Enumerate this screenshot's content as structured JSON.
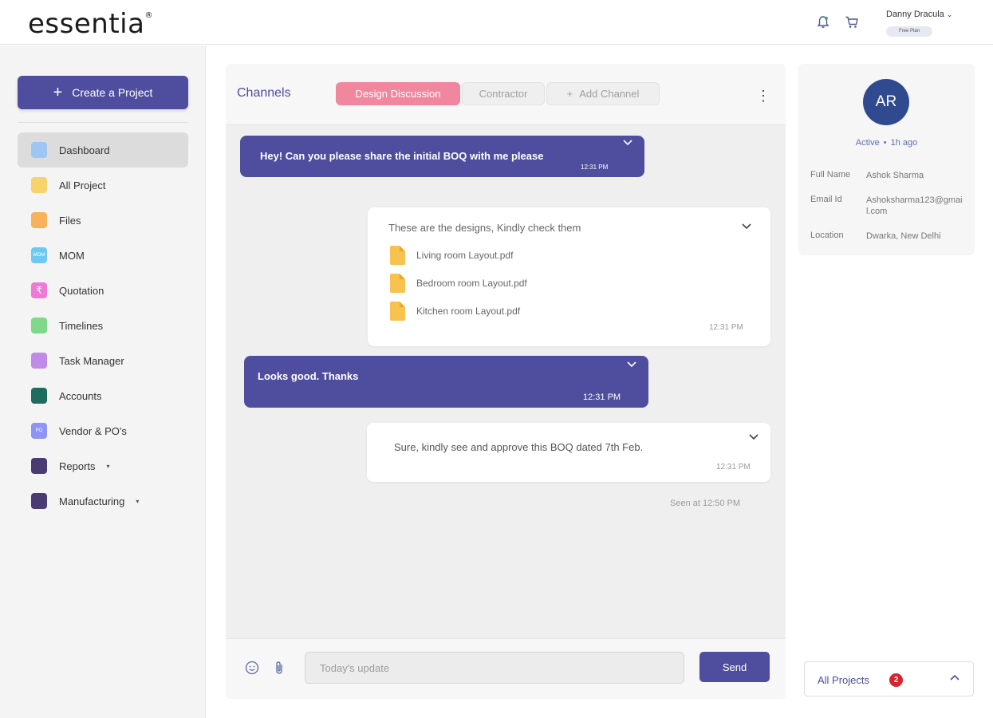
{
  "header": {
    "brand": "essentia",
    "brand_mark": "®",
    "user_name": "Danny Dracula",
    "plan_badge": "Free Plan",
    "icons": [
      "bell-icon",
      "cart-icon",
      "chevron-down-icon"
    ]
  },
  "sidebar": {
    "create_label": "Create a Project",
    "items": [
      {
        "label": "Dashboard",
        "icon": "dashboard-icon",
        "color": "#9ec6f3",
        "active": true
      },
      {
        "label": "All Project",
        "icon": "project-icon",
        "color": "#f7d36b"
      },
      {
        "label": "Files",
        "icon": "files-icon",
        "color": "#f7b25a"
      },
      {
        "label": "MOM",
        "icon": "mom-icon",
        "color": "#6ec9f2",
        "glyph": "MOM"
      },
      {
        "label": "Quotation",
        "icon": "rupee-icon",
        "color": "#ee7ad6",
        "glyph": "₹"
      },
      {
        "label": "Timelines",
        "icon": "timeline-icon",
        "color": "#7fd98a"
      },
      {
        "label": "Task Manager",
        "icon": "task-icon",
        "color": "#c08ae8"
      },
      {
        "label": "Accounts",
        "icon": "accounts-icon",
        "color": "#1f6d5f"
      },
      {
        "label": "Vendor & PO's",
        "icon": "vendor-icon",
        "color": "#8f93f5",
        "glyph": "PO"
      },
      {
        "label": "Reports",
        "icon": "reports-icon",
        "color": "#4a3b73",
        "caret": true
      },
      {
        "label": "Manufacturing",
        "icon": "manufacturing-icon",
        "color": "#4a3b73",
        "caret": true
      }
    ]
  },
  "chat": {
    "title": "Channels",
    "tabs": {
      "design": "Design Discussion",
      "contractor": "Contractor",
      "add": "Add Channel"
    },
    "messages": [
      {
        "type": "out",
        "text": "Hey! Can you please share the initial BOQ with me please",
        "time": "12:31 PM"
      },
      {
        "type": "in",
        "text": "These are the designs, Kindly check them",
        "time": "12:31 PM",
        "files": [
          "Living room Layout.pdf",
          "Bedroom room Layout.pdf",
          "Kitchen room Layout.pdf"
        ]
      },
      {
        "type": "out",
        "text": "Looks good. Thanks",
        "time": "12:31 PM"
      },
      {
        "type": "in",
        "text": "Sure, kindly see and approve this BOQ dated 7th Feb.",
        "time": "12:31 PM"
      }
    ],
    "seen": "Seen at 12:50 PM",
    "input_placeholder": "Today's update",
    "send_label": "Send"
  },
  "profile": {
    "initials": "AR",
    "status": "Active",
    "last_seen": "1h ago",
    "fields": [
      {
        "key": "Full Name",
        "value": "Ashok Sharma"
      },
      {
        "key": "Email Id",
        "value": "Ashoksharma123@gmail.com"
      },
      {
        "key": "Location",
        "value": "Dwarka, New Delhi"
      }
    ]
  },
  "projects": {
    "label": "All Projects",
    "count": "2"
  },
  "colors": {
    "accent": "#4f4e9e",
    "pink_tab": "#f1869f",
    "avatar": "#2f4a8f",
    "badge_red": "#d9232e"
  }
}
